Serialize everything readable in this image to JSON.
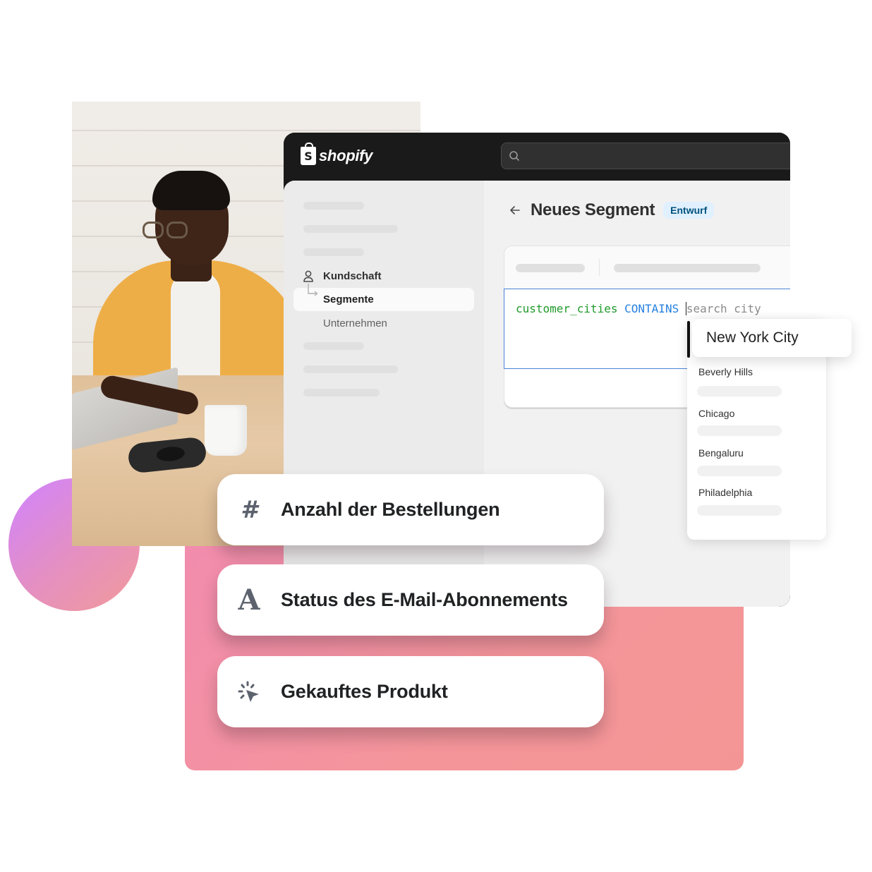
{
  "app": {
    "brand": "shopify"
  },
  "search": {
    "placeholder": ""
  },
  "sidebar": {
    "items": [
      {
        "label": "Kundschaft",
        "icon": "person-icon",
        "state": "parent"
      },
      {
        "label": "Segmente",
        "icon": "child-arrow-icon",
        "state": "active"
      },
      {
        "label": "Unternehmen",
        "state": "default"
      }
    ]
  },
  "page": {
    "title": "Neues Segment",
    "badge": "Entwurf",
    "back_icon": "arrow-left-icon"
  },
  "editor": {
    "query_field": "customer_cities",
    "query_operator": "CONTAINS",
    "query_placeholder": "search city"
  },
  "dropdown": {
    "highlighted": "New York City",
    "options": [
      "Beverly Hills",
      "Chicago",
      "Bengaluru",
      "Philadelphia"
    ]
  },
  "filters": [
    {
      "label": "Anzahl der Bestellungen",
      "icon": "hash-icon",
      "glyph": "#"
    },
    {
      "label": "Status des E-Mail-Abonnements",
      "icon": "text-letter-icon",
      "glyph": "A"
    },
    {
      "label": "Gekauftes Produkt",
      "icon": "cursor-click-icon"
    }
  ],
  "colors": {
    "accent_blue": "#4a84d8",
    "code_field_green": "#1f9a2a",
    "code_operator_blue": "#2680e0",
    "badge_bg": "#e0f0ff",
    "badge_text": "#00527c",
    "topbar": "#1a1a1a",
    "pink_panel": "#f4959a",
    "circle_gradient_start": "#d083ff",
    "circle_gradient_end": "#f29a9a"
  }
}
